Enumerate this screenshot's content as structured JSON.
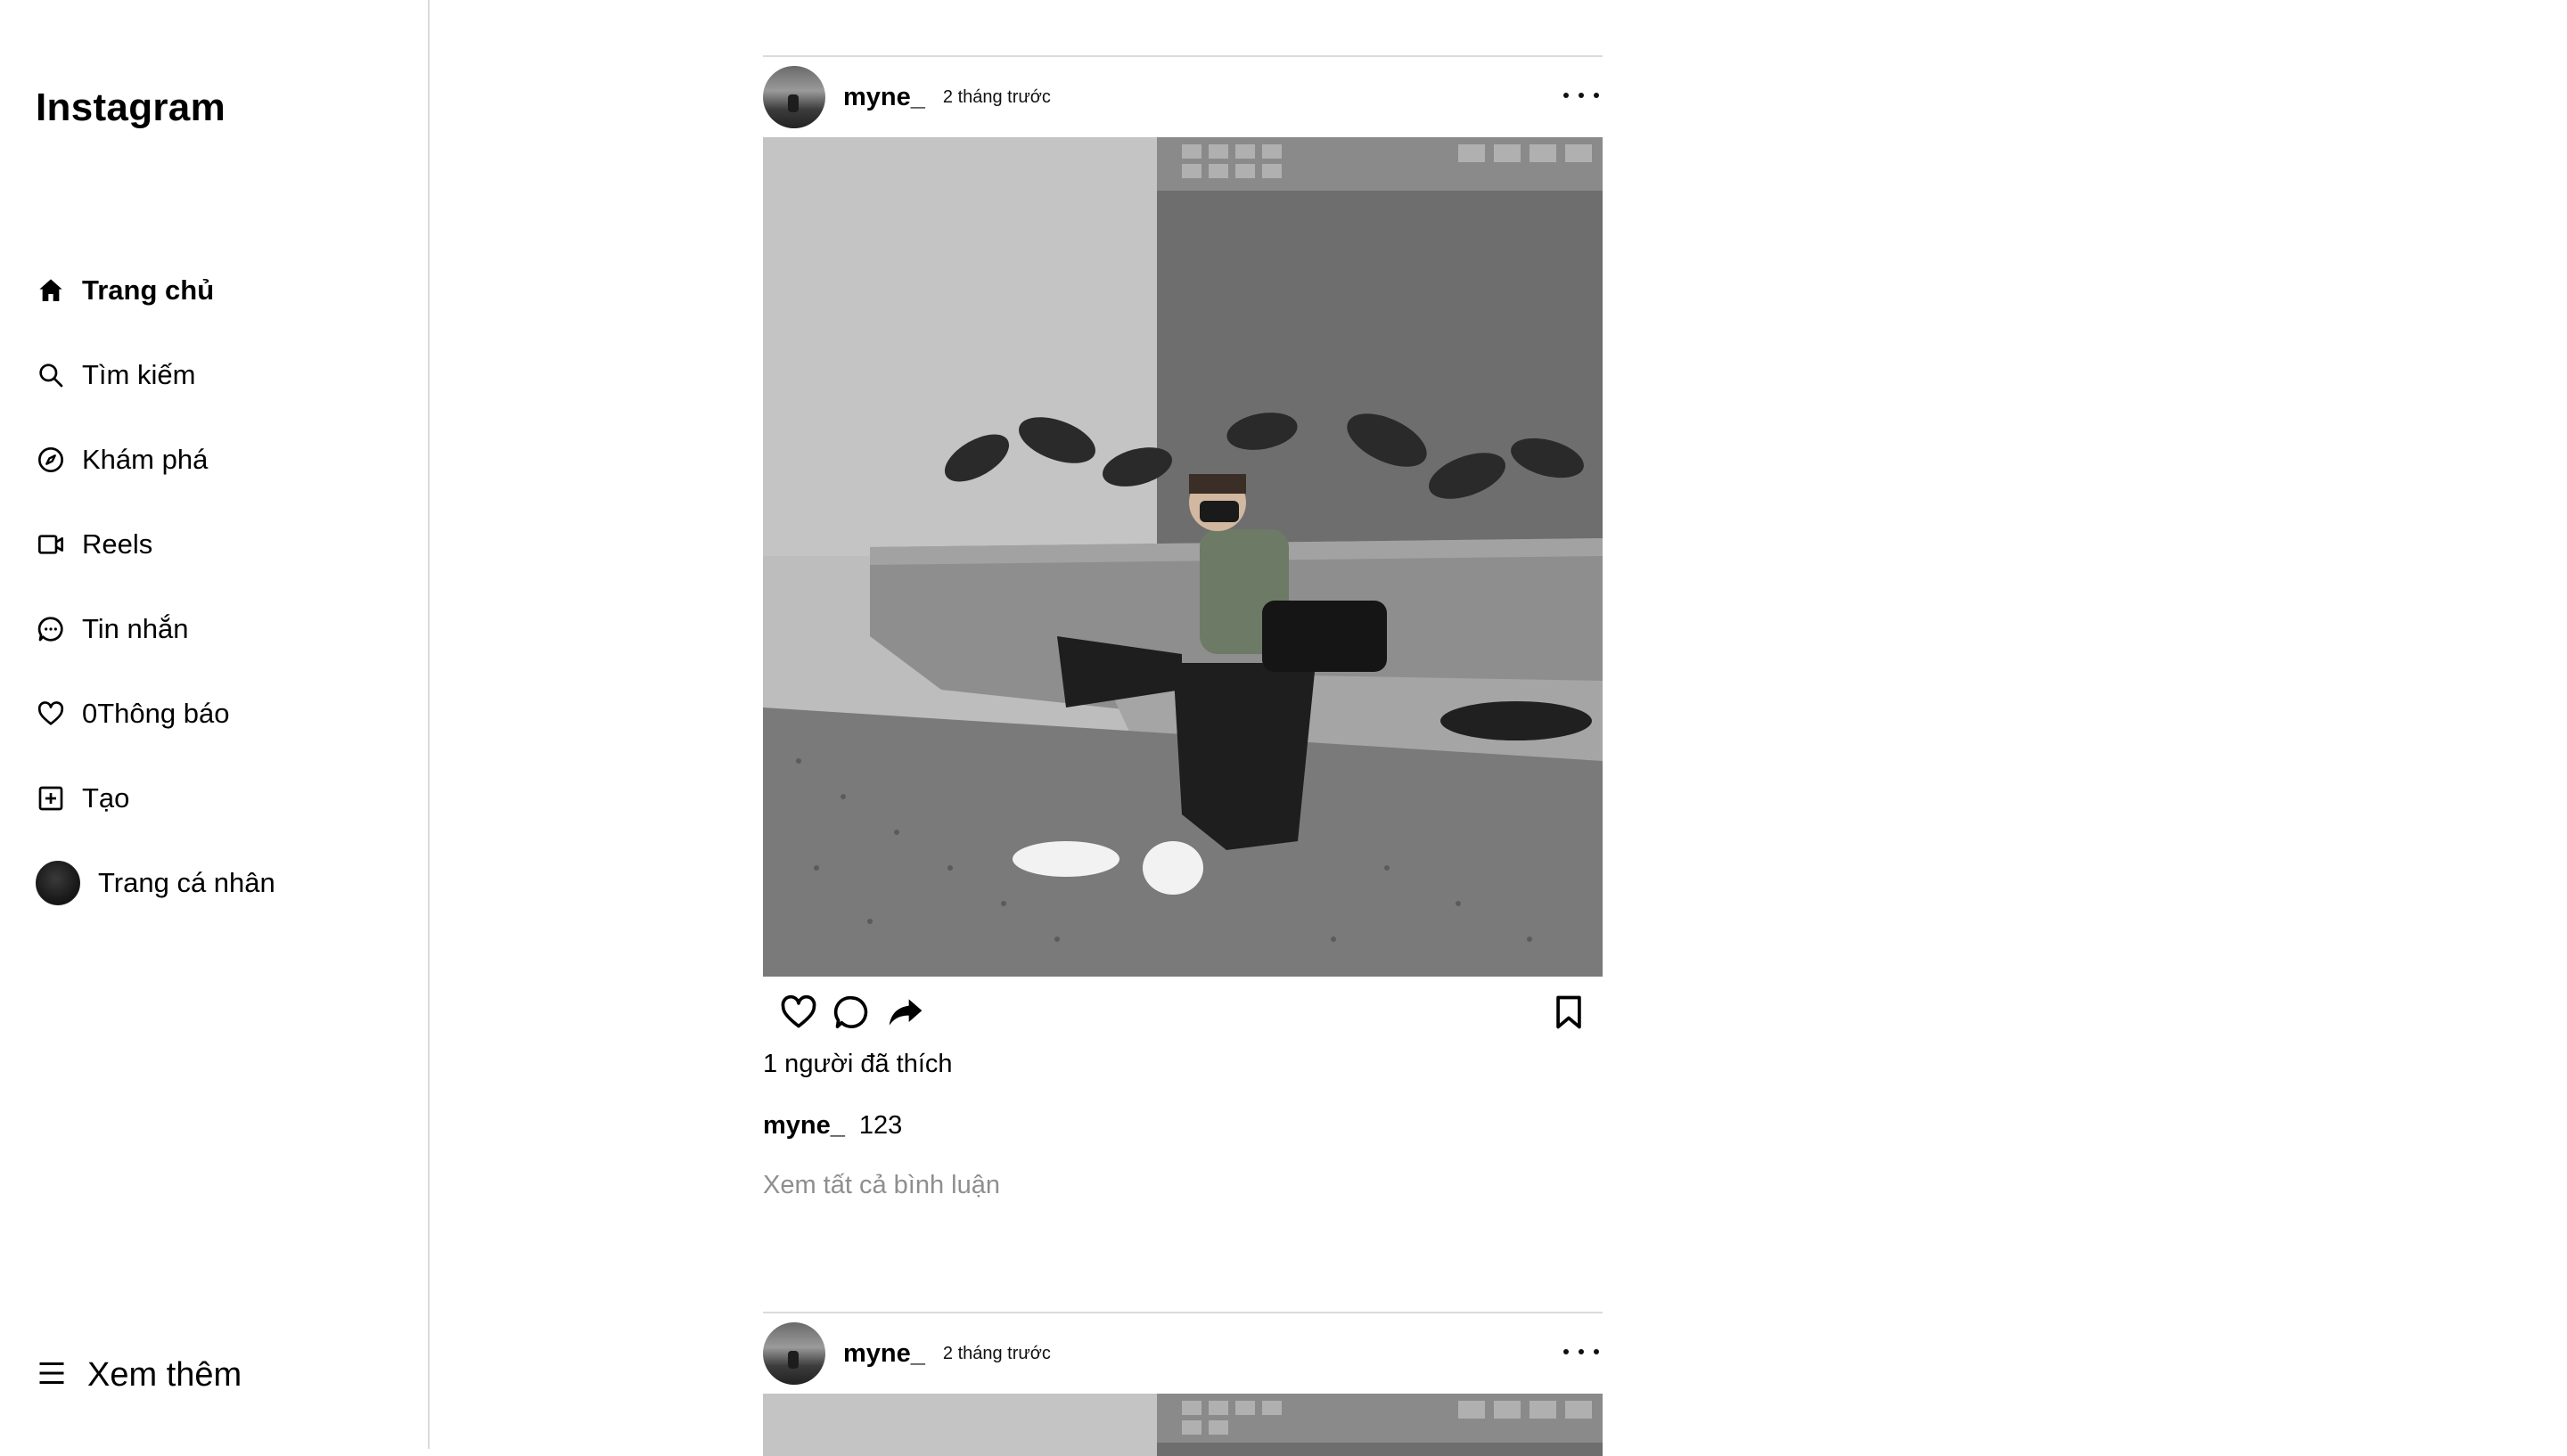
{
  "app": {
    "logo": "Instagram"
  },
  "sidebar": {
    "items": [
      {
        "label": "Trang chủ",
        "icon": "home-icon",
        "active": true
      },
      {
        "label": "Tìm kiếm",
        "icon": "search-icon"
      },
      {
        "label": "Khám phá",
        "icon": "compass-icon"
      },
      {
        "label": "Reels",
        "icon": "reels-icon"
      },
      {
        "label": "Tin nhắn",
        "icon": "message-icon"
      },
      {
        "label": "0Thông báo",
        "icon": "heart-icon"
      },
      {
        "label": "Tạo",
        "icon": "plus-square-icon"
      },
      {
        "label": "Trang cá nhân",
        "icon": "avatar"
      }
    ],
    "more_label": "Xem thêm"
  },
  "posts": [
    {
      "username": "myne_",
      "time": "2 tháng trước",
      "likes": "1 người đã thích",
      "caption_user": "myne_",
      "caption_text": "123",
      "view_comments": "Xem tất cả bình luận"
    },
    {
      "username": "myne_",
      "time": "2 tháng trước"
    }
  ]
}
